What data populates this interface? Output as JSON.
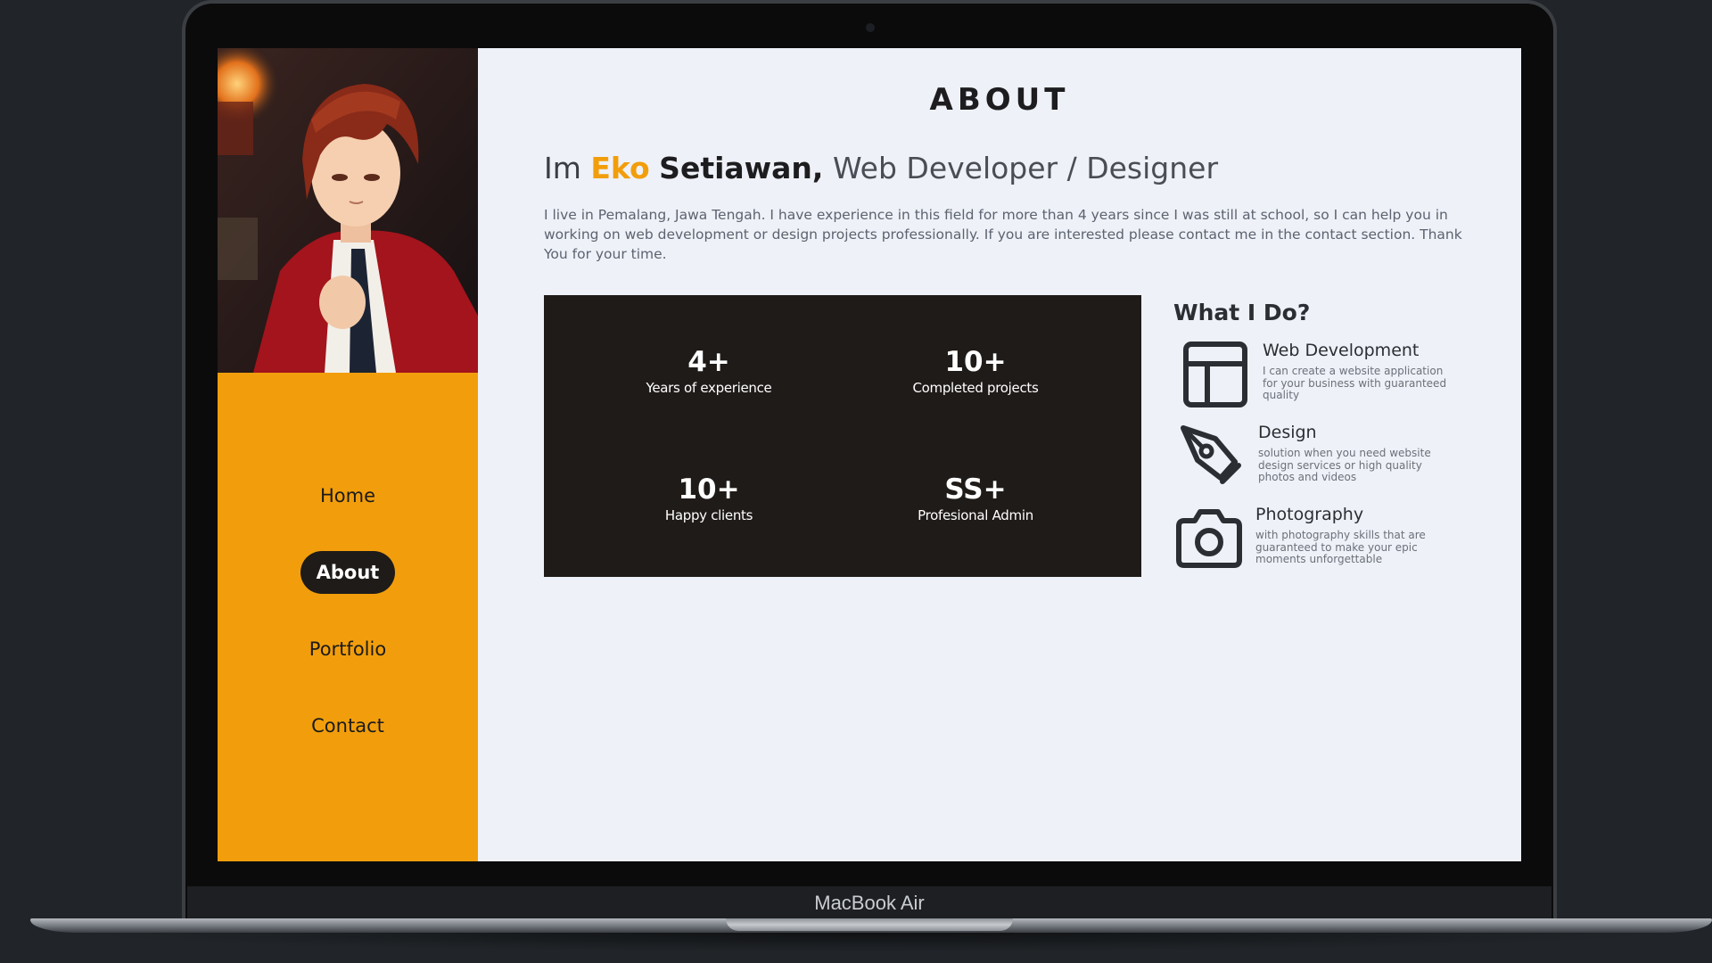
{
  "device": {
    "label": "MacBook Air"
  },
  "sidebar": {
    "nav_items": [
      {
        "label": "Home",
        "active": false
      },
      {
        "label": "About",
        "active": true
      },
      {
        "label": "Portfolio",
        "active": false
      },
      {
        "label": "Contact",
        "active": false
      }
    ]
  },
  "main": {
    "title": "ABOUT",
    "headline": {
      "prefix": "Im",
      "first_name": "Eko",
      "last_name": "Setiawan,",
      "role": "Web Developer / Designer"
    },
    "bio": "I live in Pemalang, Jawa Tengah. I have experience in this field for more than 4 years since I was still at school, so I can help you in working on web development or design projects professionally. If you are interested please contact me in the contact section. Thank You for your time.",
    "stats": [
      {
        "value": "4+",
        "label": "Years of experience"
      },
      {
        "value": "10+",
        "label": "Completed projects"
      },
      {
        "value": "10+",
        "label": "Happy clients"
      },
      {
        "value": "SS+",
        "label": "Profesional Admin"
      }
    ],
    "what_i_do": {
      "title": "What I Do?",
      "services": [
        {
          "icon": "layout-icon",
          "title": "Web Development",
          "description": "I can create a website application for your business with guaranteed quality"
        },
        {
          "icon": "pen-tool-icon",
          "title": "Design",
          "description": "solution when you need website design services or high quality photos and videos"
        },
        {
          "icon": "camera-icon",
          "title": "Photography",
          "description": "with photography skills that are guaranteed to make your epic moments unforgettable"
        }
      ]
    }
  },
  "colors": {
    "accent": "#f29e0c",
    "dark_panel": "#1f1b19",
    "screen_bg": "#eef1f7",
    "page_bg": "#212529"
  }
}
